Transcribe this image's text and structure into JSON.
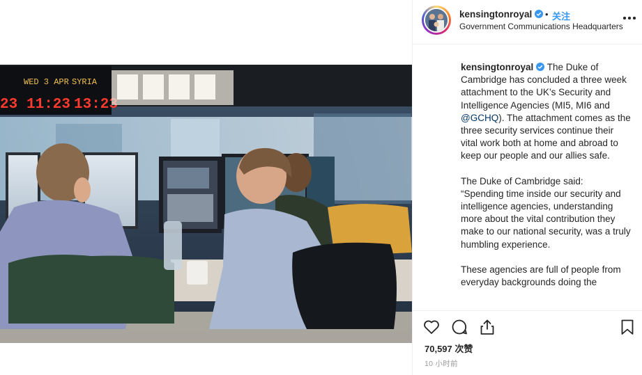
{
  "post": {
    "username": "kensingtonroyal",
    "follow_dot": "•",
    "follow_label": "关注",
    "location": "Government Communications Headquarters",
    "caption_p1_rest": " The Duke of Cambridge has concluded a three week attachment to the UK’s Security and Intelligence Agencies (MI5, MI6 and ",
    "mention": "@GCHQ",
    "caption_p1_end": "). The attachment comes as the three security services continue their vital work both at home and abroad to keep our people and our allies safe.",
    "caption_p2": "The Duke of Cambridge said:\n“Spending time inside our security and intelligence agencies, understanding more about the vital contribution they make to our national security, was a truly humbling experience.",
    "caption_p3": "These agencies are full of people from everyday backgrounds doing the",
    "likes": "70,597 次赞",
    "time_ago": "10 小时前"
  },
  "photo": {
    "board_date": "WED 3 APR",
    "board_city": "SYRIA",
    "clock_left": "23",
    "clock_mid": "11:23",
    "clock_right": "13:23"
  },
  "icons": {
    "like": "heart-icon",
    "comment": "comment-icon",
    "share": "share-icon",
    "save": "bookmark-icon",
    "verified": "verified-badge-icon",
    "more": "more-options-icon"
  },
  "colors": {
    "link_blue": "#3897f0",
    "mention": "#003569",
    "clock_red": "#ff3b2f",
    "board_amber": "#f2c14e"
  }
}
